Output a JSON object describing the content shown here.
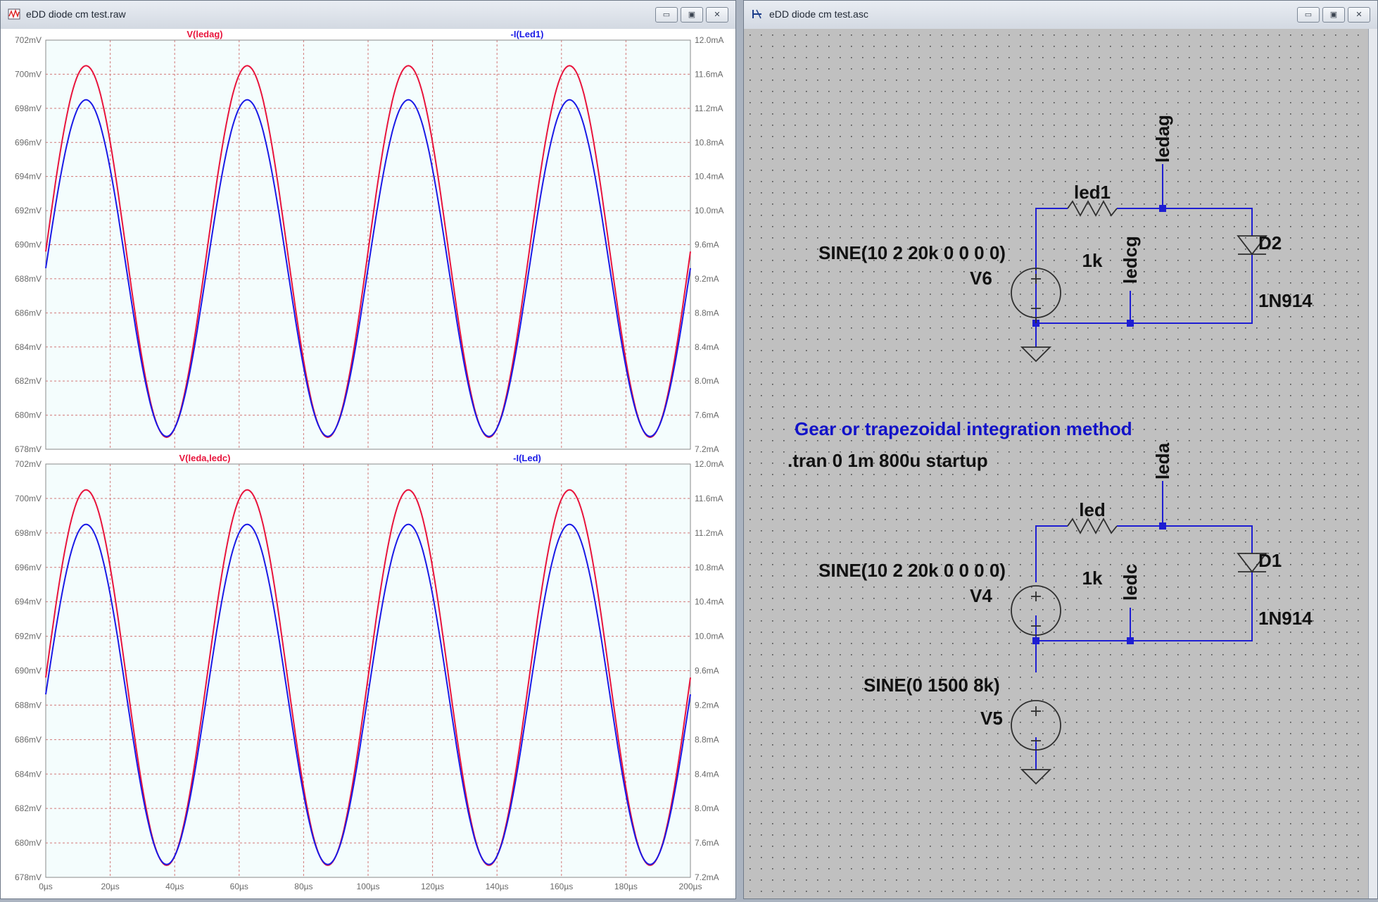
{
  "waveform_window": {
    "title": "eDD diode cm test.raw",
    "buttons": {
      "minimize": "▭",
      "restore": "▣",
      "close": "✕"
    },
    "x_ticks": [
      "0µs",
      "20µs",
      "40µs",
      "60µs",
      "80µs",
      "100µs",
      "120µs",
      "140µs",
      "160µs",
      "180µs",
      "200µs"
    ],
    "panes": [
      {
        "left_trace": "V(ledag)",
        "right_trace": "-I(Led1)",
        "left_ticks": [
          "702mV",
          "700mV",
          "698mV",
          "696mV",
          "694mV",
          "692mV",
          "690mV",
          "688mV",
          "686mV",
          "684mV",
          "682mV",
          "680mV",
          "678mV"
        ],
        "right_ticks": [
          "12.0mA",
          "11.6mA",
          "11.2mA",
          "10.8mA",
          "10.4mA",
          "10.0mA",
          "9.6mA",
          "9.2mA",
          "8.8mA",
          "8.4mA",
          "8.0mA",
          "7.6mA",
          "7.2mA"
        ]
      },
      {
        "left_trace": "V(leda,ledc)",
        "right_trace": "-I(Led)",
        "left_ticks": [
          "702mV",
          "700mV",
          "698mV",
          "696mV",
          "694mV",
          "692mV",
          "690mV",
          "688mV",
          "686mV",
          "684mV",
          "682mV",
          "680mV",
          "678mV"
        ],
        "right_ticks": [
          "12.0mA",
          "11.6mA",
          "11.2mA",
          "10.8mA",
          "10.4mA",
          "10.0mA",
          "9.6mA",
          "9.2mA",
          "8.8mA",
          "8.4mA",
          "8.0mA",
          "7.6mA",
          "7.2mA"
        ]
      }
    ],
    "colors": {
      "voltage": "#e8143c",
      "current": "#1a1ae6",
      "grid": "#d27878",
      "plot_bg": "#f4fdfd"
    }
  },
  "chart_data": [
    {
      "type": "line",
      "title": "",
      "xlabel": "",
      "ylabel": "",
      "xlim": [
        0,
        200
      ],
      "ylim": [
        678,
        702
      ],
      "y2lim": [
        7.2,
        12.0
      ],
      "series": [
        {
          "name": "V(ledag)",
          "axis": "left",
          "x": [
            0,
            12.5,
            37.5,
            62.5,
            87.5,
            112.5,
            137.5,
            162.5,
            187.5,
            200
          ],
          "values": [
            690.4,
            700.5,
            678.7,
            700.5,
            678.7,
            700.5,
            678.7,
            700.5,
            678.7,
            690.4
          ]
        },
        {
          "name": "-I(Led1)",
          "axis": "right",
          "x": [
            0,
            12.5,
            37.5,
            62.5,
            87.5,
            112.5,
            137.5,
            162.5,
            187.5,
            200
          ],
          "values": [
            9.3,
            11.3,
            7.35,
            11.3,
            7.35,
            11.3,
            7.35,
            11.3,
            7.35,
            9.3
          ]
        }
      ]
    },
    {
      "type": "line",
      "title": "",
      "xlabel": "",
      "ylabel": "",
      "xlim": [
        0,
        200
      ],
      "ylim": [
        678,
        702
      ],
      "y2lim": [
        7.2,
        12.0
      ],
      "series": [
        {
          "name": "V(leda,ledc)",
          "axis": "left",
          "x": [
            0,
            12.5,
            37.5,
            62.5,
            87.5,
            112.5,
            137.5,
            162.5,
            187.5,
            200
          ],
          "values": [
            690.4,
            700.5,
            678.7,
            700.5,
            678.7,
            700.5,
            678.7,
            700.5,
            678.7,
            690.4
          ]
        },
        {
          "name": "-I(Led)",
          "axis": "right",
          "x": [
            0,
            12.5,
            37.5,
            62.5,
            87.5,
            112.5,
            137.5,
            162.5,
            187.5,
            200
          ],
          "values": [
            9.3,
            11.3,
            7.35,
            11.3,
            7.35,
            11.3,
            7.35,
            11.3,
            7.35,
            9.3
          ]
        }
      ]
    }
  ],
  "schematic_window": {
    "title": "eDD diode cm test.asc",
    "buttons": {
      "minimize": "▭",
      "restore": "▣",
      "close": "✕"
    },
    "circuit1": {
      "source_value": "SINE(10 2 20k 0 0 0 0)",
      "source_name": "V6",
      "resistor_name": "led1",
      "resistor_value": "1k",
      "net_top": "ledag",
      "net_mid": "ledcg",
      "diode_name": "D2",
      "diode_model": "1N914"
    },
    "directives": {
      "comment": "Gear or trapezoidal integration method",
      "tran": ".tran 0 1m 800u startup"
    },
    "circuit2": {
      "source_value": "SINE(10 2 20k 0 0 0 0)",
      "source_name": "V4",
      "resistor_name": "led",
      "resistor_value": "1k",
      "net_top": "leda",
      "net_mid": "ledc",
      "diode_name": "D1",
      "diode_model": "1N914",
      "source2_value": "SINE(0 1500 8k)",
      "source2_name": "V5"
    },
    "colors": {
      "wire": "#1e1ed2",
      "comment": "#1212c8",
      "bg": "#c0c0c0"
    }
  }
}
